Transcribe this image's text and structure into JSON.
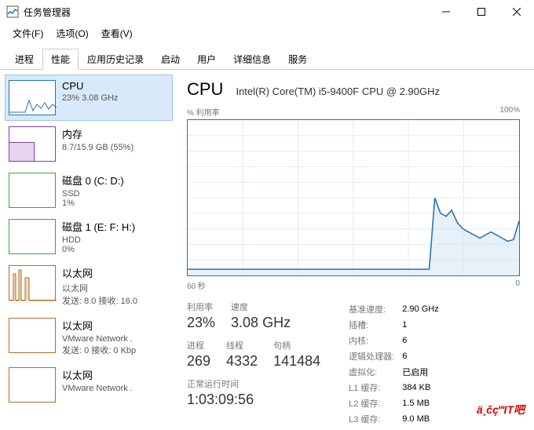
{
  "window": {
    "title": "任务管理器"
  },
  "menus": {
    "file": "文件(F)",
    "options": "选项(O)",
    "view": "查看(V)"
  },
  "tabs": {
    "processes": "进程",
    "performance": "性能",
    "app_history": "应用历史记录",
    "startup": "启动",
    "users": "用户",
    "details": "详细信息",
    "services": "服务"
  },
  "sidebar": [
    {
      "name": "CPU",
      "sub": "23% 3.08 GHz",
      "color": "#2372b8"
    },
    {
      "name": "内存",
      "sub": "8.7/15.9 GB (55%)",
      "color": "#8a3ab9"
    },
    {
      "name": "磁盘 0 (C: D:)",
      "sub": "SSD",
      "sub2": "1%",
      "color": "#3fa33f"
    },
    {
      "name": "磁盘 1 (E: F: H:)",
      "sub": "HDD",
      "sub2": "0%",
      "color": "#3fa33f"
    },
    {
      "name": "以太网",
      "sub": "以太网",
      "sub2": "发送: 8.0 接收: 16.0",
      "color": "#b06c2a"
    },
    {
      "name": "以太网",
      "sub": "VMware Network .",
      "sub2": "发送: 0 接收: 0 Kbp",
      "color": "#b06c2a"
    },
    {
      "name": "以太网",
      "sub": "VMware Network .",
      "sub2": "",
      "color": "#b06c2a"
    }
  ],
  "main": {
    "title": "CPU",
    "model": "Intel(R) Core(TM) i5-9400F CPU @ 2.90GHz",
    "chart_ylabel": "% 利用率",
    "chart_ymax": "100%",
    "chart_xleft": "60 秒",
    "chart_xright": "0",
    "labels": {
      "util": "利用率",
      "speed": "速度",
      "proc": "进程",
      "threads": "线程",
      "handles": "句柄",
      "uptime": "正常运行时间",
      "base_speed": "基准速度:",
      "sockets": "插槽:",
      "cores": "内核:",
      "logical": "逻辑处理器:",
      "virt": "虚拟化:",
      "l1": "L1 缓存:",
      "l2": "L2 缓存:",
      "l3": "L3 缓存:"
    },
    "values": {
      "util": "23%",
      "speed": "3.08 GHz",
      "proc": "269",
      "threads": "4332",
      "handles": "141484",
      "uptime": "1:03:09:56",
      "base_speed": "2.90 GHz",
      "sockets": "1",
      "cores": "6",
      "logical": "6",
      "virt": "已启用",
      "l1": "384 KB",
      "l2": "1.5 MB",
      "l3": "9.0 MB"
    }
  },
  "watermark": "ä¸čç‴IT吧",
  "chart_data": {
    "type": "line",
    "title": "% 利用率",
    "xlabel": "秒",
    "ylabel": "% 利用率",
    "ylim": [
      0,
      100
    ],
    "xlim_seconds": [
      60,
      0
    ],
    "series": [
      {
        "name": "CPU利用率",
        "values_pct": [
          4,
          4,
          4,
          4,
          4,
          4,
          4,
          4,
          4,
          4,
          4,
          4,
          4,
          4,
          4,
          4,
          4,
          4,
          4,
          4,
          4,
          4,
          4,
          4,
          4,
          4,
          4,
          4,
          4,
          4,
          4,
          4,
          4,
          4,
          4,
          4,
          4,
          4,
          4,
          4,
          4,
          4,
          4,
          4,
          50,
          40,
          38,
          42,
          34,
          30,
          28,
          26,
          24,
          26,
          28,
          26,
          24,
          22,
          23,
          35
        ]
      }
    ]
  }
}
